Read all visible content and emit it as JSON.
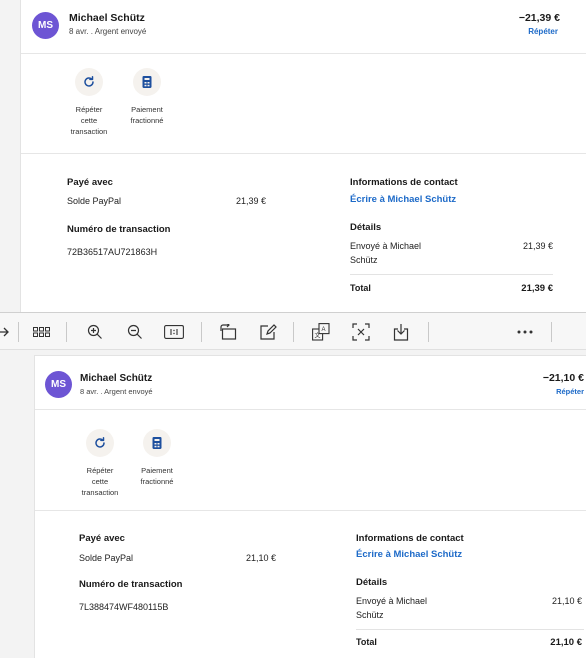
{
  "top": {
    "avatar": "MS",
    "name": "Michael Schütz",
    "subtitle": "8 avr. . Argent envoyé",
    "amount": "−21,39 €",
    "repeat_link": "Répéter",
    "actions": [
      {
        "icon": "repeat-icon",
        "l1": "Répéter",
        "l2": "cette",
        "l3": "transaction"
      },
      {
        "icon": "split-payment-icon",
        "l1": "Paiement",
        "l2": "fractionné",
        "l3": ""
      }
    ],
    "paid_with_label": "Payé avec",
    "paid_with_method": "Solde PayPal",
    "paid_with_amount": "21,39 €",
    "txn_label": "Numéro de transaction",
    "txn_id": "72B36517AU721863H",
    "contact_label": "Informations de contact",
    "contact_link": "Écrire à Michael Schütz",
    "details_label": "Détails",
    "details_l1": "Envoyé à Michael",
    "details_l2": "Schütz",
    "details_amount": "21,39 €",
    "total_label": "Total",
    "total_amount": "21,39 €"
  },
  "bottom": {
    "avatar": "MS",
    "name": "Michael Schütz",
    "subtitle": "8 avr. . Argent envoyé",
    "amount": "−21,10 €",
    "repeat_link": "Répéter",
    "actions": [
      {
        "icon": "repeat-icon",
        "l1": "Répéter",
        "l2": "cette",
        "l3": "transaction"
      },
      {
        "icon": "split-payment-icon",
        "l1": "Paiement",
        "l2": "fractionné",
        "l3": ""
      }
    ],
    "paid_with_label": "Payé avec",
    "paid_with_method": "Solde PayPal",
    "paid_with_amount": "21,10 €",
    "txn_label": "Numéro de transaction",
    "txn_id": "7L388474WF480115B",
    "contact_label": "Informations de contact",
    "contact_link": "Écrire à Michael Schütz",
    "details_label": "Détails",
    "details_l1": "Envoyé à Michael",
    "details_l2": "Schütz",
    "details_amount": "21,10 €",
    "total_label": "Total",
    "total_amount": "21,10 €"
  },
  "toolbar": {
    "icons": [
      "forward-arrow-icon",
      "grid-view-icon",
      "zoom-in-icon",
      "zoom-out-icon",
      "actual-size-icon",
      "rotate-icon",
      "edit-icon",
      "translate-icon",
      "text-recognition-icon",
      "share-icon",
      "more-icon"
    ]
  },
  "colors": {
    "avatar": "#6d55d4",
    "link": "#1d6ac8",
    "action_bg": "#f5f2ee",
    "icon_blue": "#1d4f9e"
  }
}
